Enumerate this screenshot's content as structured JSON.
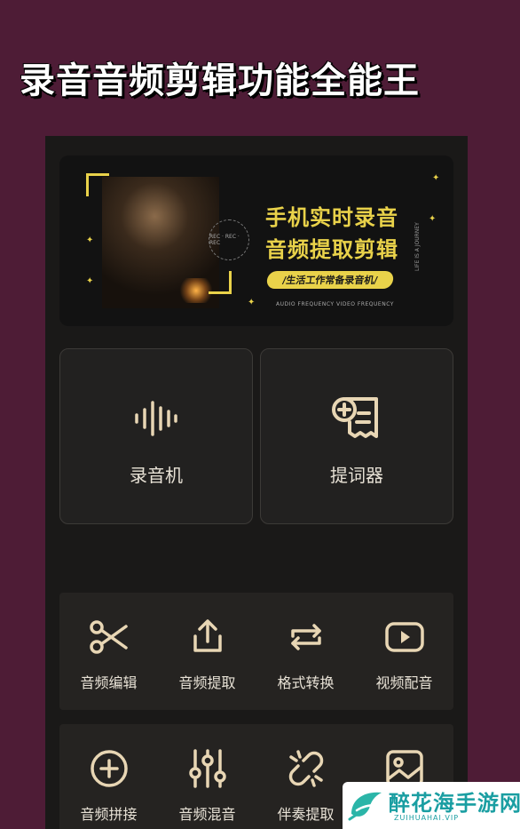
{
  "headline": "录音音频剪辑功能全能王",
  "banner": {
    "line1": "手机实时录音",
    "line2": "音频提取剪辑",
    "pill": "/生活工作常备录音机/",
    "small_caption": "AUDIO FREQUENCY   VIDEO FREQUENCY",
    "side_caption": "LIFE IS A JOURNEY",
    "rec_ring": "REC · REC · REC"
  },
  "cards": [
    {
      "label": "录音机",
      "icon": "waveform-icon"
    },
    {
      "label": "提词器",
      "icon": "teleprompter-icon"
    }
  ],
  "tools_row1": [
    {
      "label": "音频编辑",
      "icon": "scissors-icon"
    },
    {
      "label": "音频提取",
      "icon": "share-upload-icon"
    },
    {
      "label": "格式转换",
      "icon": "repeat-icon"
    },
    {
      "label": "视频配音",
      "icon": "play-icon"
    }
  ],
  "tools_row2": [
    {
      "label": "音频拼接",
      "icon": "plus-circle-icon"
    },
    {
      "label": "音频混音",
      "icon": "sliders-icon"
    },
    {
      "label": "伴奏提取",
      "icon": "broken-link-icon"
    },
    {
      "label": "",
      "icon": "image-icon"
    }
  ],
  "watermark": {
    "title": "醉花海手游网",
    "subtitle": "ZUIHUAHAI.VIP"
  },
  "colors": {
    "background": "#4e1c36",
    "accent_yellow": "#e9d24a",
    "icon_beige": "#e8d6b4",
    "panel": "#252321"
  }
}
